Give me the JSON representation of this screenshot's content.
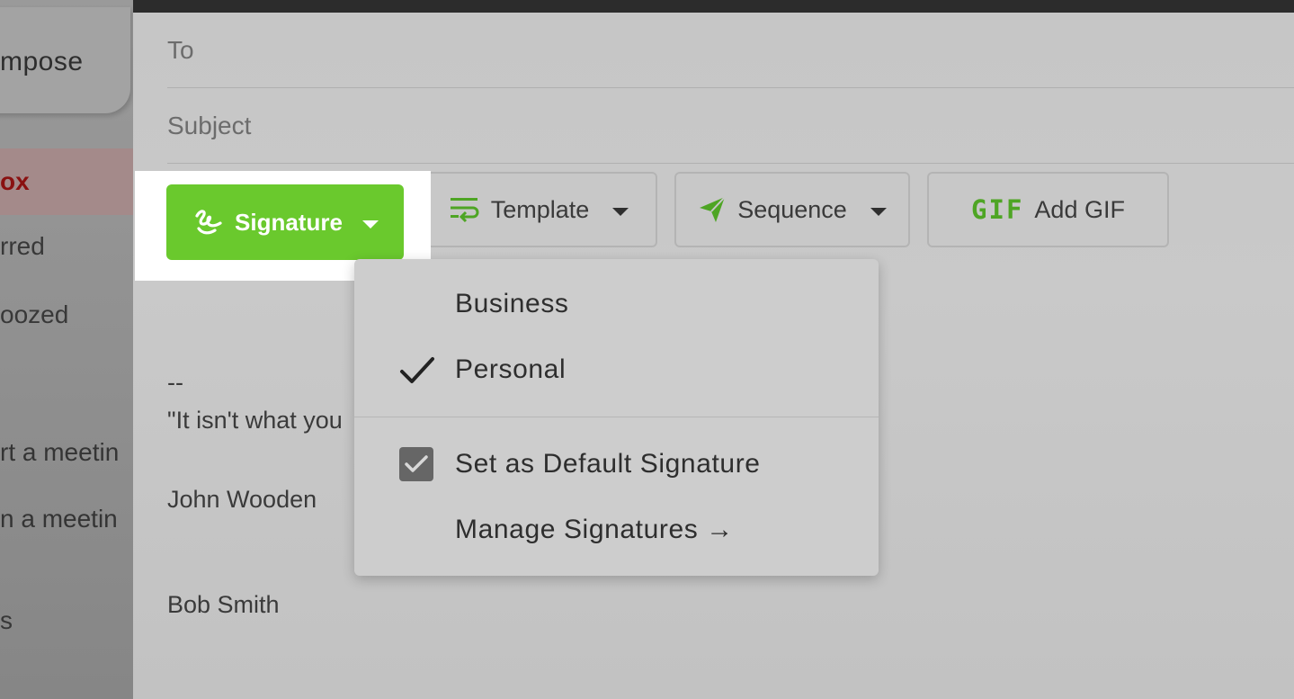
{
  "sidebar": {
    "compose_label": "mpose",
    "items": [
      {
        "label": "ox",
        "active": true
      },
      {
        "label": "rred"
      },
      {
        "label": "oozed"
      },
      {
        "label": "rt a meetin"
      },
      {
        "label": "n a meetin"
      },
      {
        "label": "s"
      }
    ]
  },
  "compose": {
    "to_placeholder": "To",
    "subject_placeholder": "Subject",
    "toolbar": {
      "signature_label": "Signature",
      "template_label": "Template",
      "sequence_label": "Sequence",
      "gif_badge": "GIF",
      "gif_label": "Add GIF"
    },
    "body": {
      "separator": "--",
      "quote": "\"It isn't what you",
      "author": "John Wooden",
      "sender": "Bob Smith"
    }
  },
  "signature_menu": {
    "options": [
      {
        "label": "Business",
        "checked": false
      },
      {
        "label": "Personal",
        "checked": true
      }
    ],
    "default_checkbox_label": "Set as Default Signature",
    "default_checked": true,
    "manage_label": "Manage Signatures →"
  },
  "colors": {
    "signature_green": "#6ac92d",
    "accent_green": "#4ea524",
    "active_nav_text": "#8a1111"
  }
}
